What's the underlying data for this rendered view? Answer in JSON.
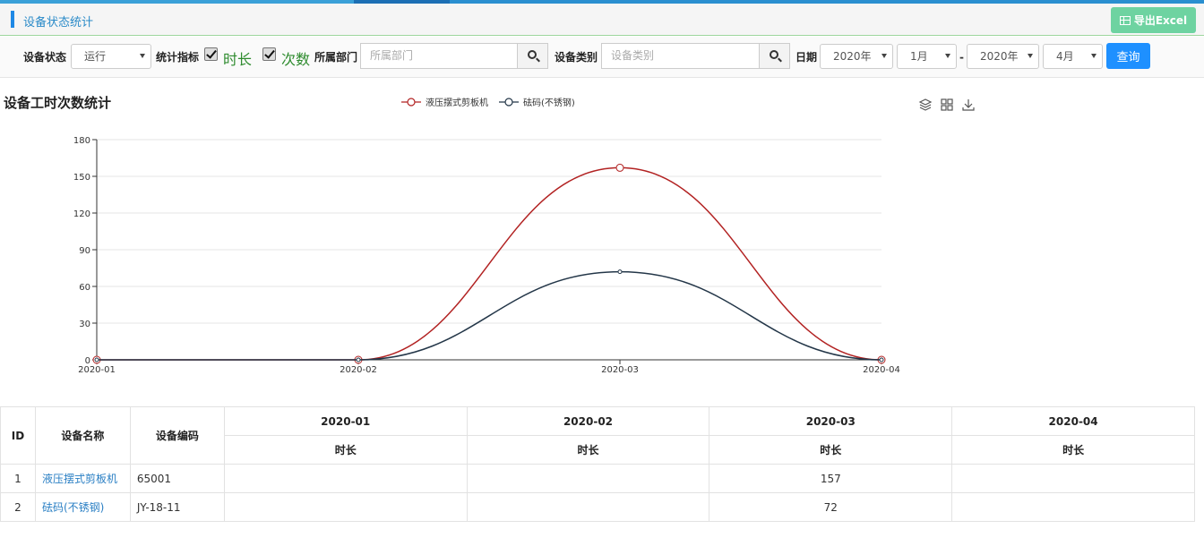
{
  "header": {
    "title": "设备状态统计",
    "export_label": "导出Excel"
  },
  "filters": {
    "status_label": "设备状态",
    "status_value": "运行",
    "metric_label": "统计指标",
    "metric_duration": "时长",
    "metric_count": "次数",
    "dept_label": "所属部门",
    "dept_placeholder": "所属部门",
    "category_label": "设备类别",
    "category_placeholder": "设备类别",
    "date_label": "日期",
    "year_from": "2020年",
    "month_from": "1月",
    "dash": "-",
    "year_to": "2020年",
    "month_to": "4月",
    "query_label": "查询"
  },
  "chart": {
    "title": "设备工时次数统计"
  },
  "chart_data": {
    "type": "line",
    "smooth": true,
    "x": [
      "2020-01",
      "2020-02",
      "2020-03",
      "2020-04"
    ],
    "series": [
      {
        "name": "液压摆式剪板机",
        "values": [
          0,
          0,
          157,
          0
        ],
        "color": "#b22222"
      },
      {
        "name": "砝码(不锈钢)",
        "values": [
          0,
          0,
          72,
          0
        ],
        "color": "#233648"
      }
    ],
    "ylim": [
      0,
      180
    ],
    "yticks": [
      0,
      30,
      60,
      90,
      120,
      150,
      180
    ],
    "grid": true,
    "legend": "top-center"
  },
  "table": {
    "h_id": "ID",
    "h_name": "设备名称",
    "h_code": "设备编码",
    "months": [
      "2020-01",
      "2020-02",
      "2020-03",
      "2020-04"
    ],
    "sub": "时长",
    "rows": [
      {
        "id": "1",
        "name": "液压摆式剪板机",
        "code": "65001",
        "vals": [
          "",
          "",
          "157",
          ""
        ]
      },
      {
        "id": "2",
        "name": "砝码(不锈钢)",
        "code": "JY-18-11",
        "vals": [
          "",
          "",
          "72",
          ""
        ]
      }
    ]
  }
}
